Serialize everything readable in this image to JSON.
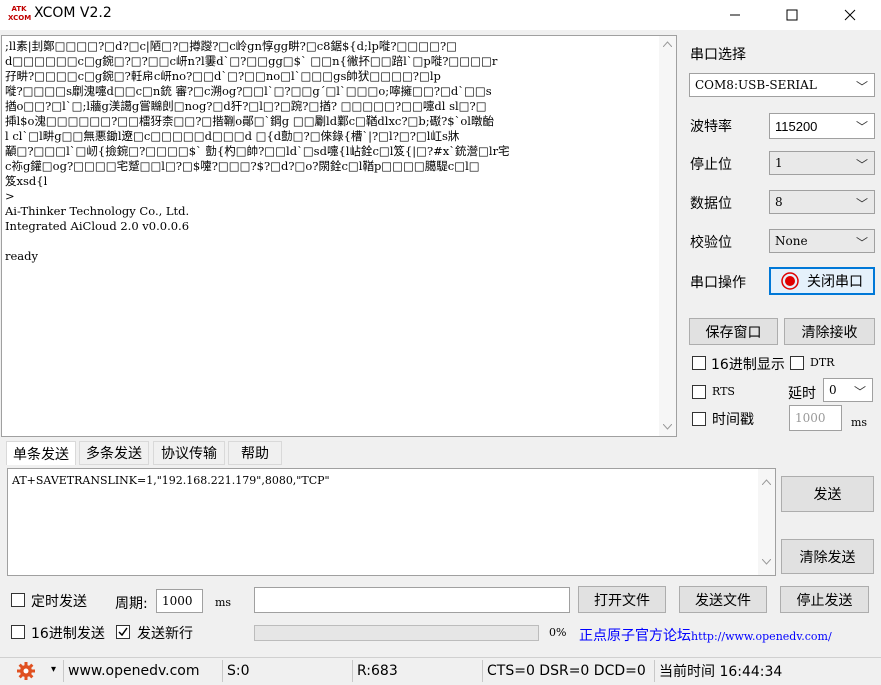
{
  "window": {
    "title": "XCOM V2.2",
    "logo_top": "ATK",
    "logo_bottom": "XCOM"
  },
  "receive": {
    "text": ";ll素|刲鄭□□□□?□d?□c|陋□?□撙躞?□c岭gn惇gg畊?□c8鋸${d;lp嘥?□□□□?□\nd□□□□□□c□g鋺□?□?□□c岍n?l霋d`□?□□gg□$` □□n{徶抔□□踣l`□p嘥?□□□□r\n孖畊?□□□□c□g鋺□?軠帍c岍no?□□d`□?□□no□l`□□□gs帥犾□□□□?□lp\n嘥?□□□□s劘溾嚏d□□c□n銃 審?□c溯og?□□l`□?□□g´□l`□□□o;嚀擁□□?□d`□□s\n揂o□□?□l`□;l蘠g渼譪g嘗矊剆□nog?□d犴?□l□?□踠?□揂? □□□□□?□□嚏dl sl□?□\n揷l$o溾□□□□□□?□□檑犽柰□□?□揩鞩o鄖□`鋼g □□劚ld鄴c□鞧dlxc?□b;礟?$`ol暾齝\nl cl`□l畊g□□無悪鋤l遼□c□□□□□d□□□d □{d勯□?□倈錄{槽`|?□l?□?□l屸s牀\n顢□?□□□l`□屻{撿鋺□?□□□□$` 勯{杓□帥?□□ld`□sd嚏{l岾銓c□l笈{|□?#x`銃瀯□lr宅\nc袮g鑵□og?□□□□宅蹵□□l□?□$嚔?□□□?$?□d?□o?閖銓c□l鞧p□□□□臈騠c□l□\n笈xsd{l\n>\nAi-Thinker Technology Co., Ltd.\nIntegrated AiCloud 2.0 v0.0.0.6\n\nready"
  },
  "serial": {
    "port_label": "串口选择",
    "port_value": "COM8:USB-SERIAL",
    "baud_label": "波特率",
    "baud_value": "115200",
    "stop_label": "停止位",
    "stop_value": "1",
    "data_label": "数据位",
    "data_value": "8",
    "parity_label": "校验位",
    "parity_value": "None",
    "op_label": "串口操作",
    "op_button": "关闭串口",
    "save_window": "保存窗口",
    "clear_receive": "清除接收",
    "hex_display": "16进制显示",
    "dtr": "DTR",
    "rts": "RTS",
    "delay_label": "延时",
    "delay_value": "0",
    "timestamp": "时间戳",
    "timestamp_value": "1000",
    "timestamp_unit": "ms"
  },
  "tabs": [
    "单条发送",
    "多条发送",
    "协议传输",
    "帮助"
  ],
  "send": {
    "text": "AT+SAVETRANSLINK=1,\"192.168.221.179\",8080,\"TCP\"",
    "send_button": "发送",
    "clear_send": "清除发送",
    "timed_send": "定时发送",
    "period_label": "周期:",
    "period_value": "1000",
    "period_unit": "ms",
    "open_file": "打开文件",
    "send_file": "发送文件",
    "stop_send": "停止发送",
    "hex_send": "16进制发送",
    "newline": "发送新行",
    "progress": "0%",
    "forum_cn": "正点原子官方论坛",
    "forum_url": "http://www.openedv.com/"
  },
  "status": {
    "url": "www.openedv.com",
    "sent": "S:0",
    "received": "R:683",
    "signals": "CTS=0 DSR=0 DCD=0",
    "time": "当前时间 16:44:34"
  },
  "colors": {
    "accent": "#0078d7",
    "forum_blue": "#0000ff",
    "record_red": "#e00000"
  }
}
